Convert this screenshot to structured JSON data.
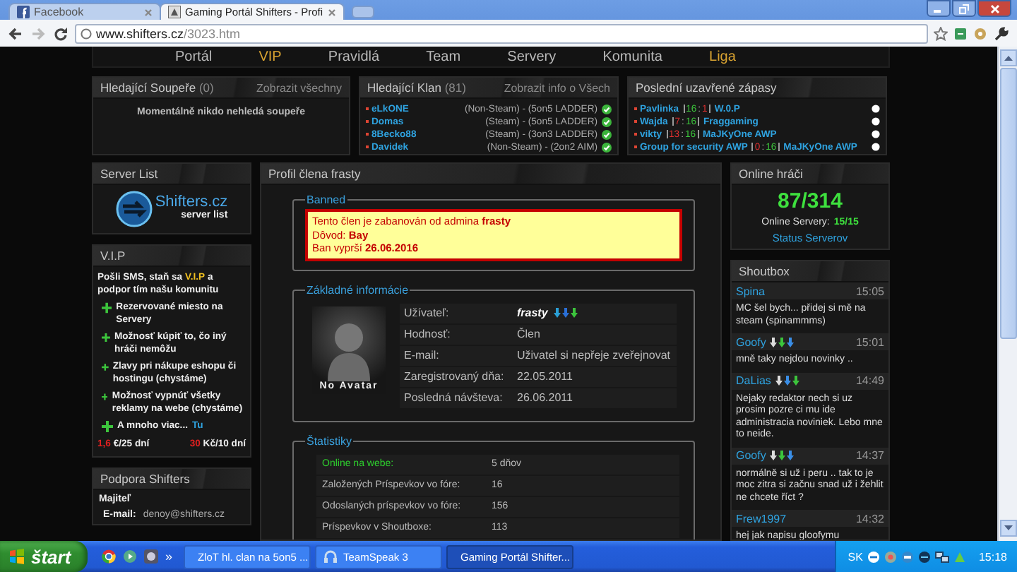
{
  "browser": {
    "tabs": [
      {
        "title": "Facebook",
        "selected": false
      },
      {
        "title": "Gaming Portál Shifters - Profi",
        "selected": true
      }
    ],
    "address": {
      "host": "www.shifters.cz",
      "path": "/3023.htm"
    }
  },
  "nav": [
    {
      "label": "Portál",
      "highlighted": false
    },
    {
      "label": "VIP",
      "highlighted": true
    },
    {
      "label": "Pravidlá",
      "highlighted": false
    },
    {
      "label": "Team",
      "highlighted": false
    },
    {
      "label": "Servery",
      "highlighted": false
    },
    {
      "label": "Komunita",
      "highlighted": false
    },
    {
      "label": "Liga",
      "highlighted": true
    }
  ],
  "seeking_opponents": {
    "title": "Hledající Soupeře",
    "count": "(0)",
    "link": "Zobrazit všechny",
    "message": "Momentálně nikdo nehledá soupeře"
  },
  "seeking_clan": {
    "title": "Hledající Klan",
    "count": "(81)",
    "link": "Zobrazit info o Všech",
    "entries": [
      {
        "name": "eLkONE",
        "details": "(Non-Steam) - (5on5 LADDER)"
      },
      {
        "name": "Domas",
        "details": "(Steam) - (5on5 LADDER)"
      },
      {
        "name": "8Becko88",
        "details": "(Steam) - (3on3 LADDER)"
      },
      {
        "name": "Davidek",
        "details": "(Non-Steam) - (2on2 AIM)"
      }
    ]
  },
  "recent_matches": {
    "title": "Poslední uzavřené zápasy",
    "separator": ":",
    "matches": [
      {
        "team_1": "Pavlinka",
        "score_1": {
          "value": "16",
          "won": true
        },
        "score_2": {
          "value": "1",
          "won": false
        },
        "team_2": "W.0.P"
      },
      {
        "team_1": "Wajda",
        "score_1": {
          "value": "7",
          "won": false
        },
        "score_2": {
          "value": "16",
          "won": true
        },
        "team_2": "Fraggaming"
      },
      {
        "team_1": "vikty",
        "score_1": {
          "value": "13",
          "won": false
        },
        "score_2": {
          "value": "16",
          "won": true
        },
        "team_2": "MaJKyOne AWP"
      },
      {
        "team_1": "Group for security AWP",
        "score_1": {
          "value": "0",
          "won": false
        },
        "score_2": {
          "value": "16",
          "won": true
        },
        "team_2": "MaJKyOne AWP"
      }
    ]
  },
  "server_list": {
    "title": "Server List",
    "logo_title": "Shifters.cz",
    "logo_subtitle": "server list"
  },
  "vip": {
    "title": "V.I.P",
    "intro": "Pošli SMS, staň sa **V.I.P** a podpor tím našu komunitu",
    "benefits": [
      "Rezervované miesto na Servery",
      "Možnosť kúpiť to, čo iný hráči nemôžu",
      "Zlavy pri nákupe eshopu či hostingu (chystáme)",
      "Možnosť vypnúť všetky reklamy na webe (chystáme)"
    ],
    "more": {
      "text": "A mnoho viac...",
      "link": "Tu"
    },
    "prices": [
      {
        "amount": "1,6",
        "unit": "€/25 dní"
      },
      {
        "amount": "30",
        "unit": "Kč/10 dní"
      }
    ]
  },
  "support": {
    "title": "Podpora Shifters",
    "role": "Majiteľ",
    "email_label": "E-mail:",
    "email": "denoy@shifters.cz"
  },
  "profile": {
    "title": "Profil člena frasty",
    "ban": {
      "legend": "Banned",
      "lines": [
        "Tento člen je zabanován od admina **frasty**",
        "Dôvod: **Bay**",
        "Ban vyprší **26.06.2016**"
      ]
    },
    "info": {
      "legend": "Základné informácie",
      "avatar_caption": "No Avatar",
      "rows": [
        {
          "kind": "user",
          "label": "Užívateľ:",
          "value": "frasty",
          "badges": [
            {
              "color": "#2a9fd6"
            },
            {
              "color": "#2a6fd6"
            },
            {
              "color": "#3cc43c"
            }
          ]
        },
        {
          "kind": "text",
          "label": "Hodnosť:",
          "value": "Člen"
        },
        {
          "kind": "text",
          "label": "E-mail:",
          "value": "Uživatel si nepřeje zveřejnovat"
        },
        {
          "kind": "text",
          "label": "Zaregistrovaný dňa:",
          "value": "22.05.2011"
        },
        {
          "kind": "text",
          "label": "Posledná návšteva:",
          "value": "26.06.2011"
        }
      ]
    },
    "stats": {
      "legend": "Štatistiky",
      "rows": [
        {
          "label": "Online na webe:",
          "value": "5 dňov",
          "highlighted": true
        },
        {
          "label": "Založených Príspevkov vo fóre:",
          "value": "16",
          "highlighted": false
        },
        {
          "label": "Odoslaných príspevkov vo fóre:",
          "value": "156",
          "highlighted": false
        },
        {
          "label": "Príspevkov v Shoutboxe:",
          "value": "113",
          "highlighted": false
        }
      ]
    }
  },
  "online": {
    "title": "Online hráči",
    "players": "87/314",
    "servers_label": "Online Servery:",
    "servers_value": "15/15",
    "status_link": "Status Serverov"
  },
  "shoutbox": {
    "title": "Shoutbox",
    "posts": [
      {
        "author": "Spina",
        "time": "15:05",
        "message": "MC šel bych... přidej si mě na steam (spinammms)"
      },
      {
        "author": "Goofy",
        "time": "15:01",
        "message": "mně taky nejdou novinky ..",
        "badges": [
          {
            "color": "#dddddd"
          },
          {
            "color": "#3cc43c"
          },
          {
            "color": "#3a8ee6"
          }
        ]
      },
      {
        "author": "DaLias",
        "time": "14:49",
        "message": "Nejaky redaktor nech si uz prosim pozre ci mu ide administracia noviniek. Lebo mne to neide.",
        "badges": [
          {
            "color": "#dddddd"
          },
          {
            "color": "#3a8ee6"
          },
          {
            "color": "#3cc43c"
          }
        ]
      },
      {
        "author": "Goofy",
        "time": "14:37",
        "message": "normálně si už i peru .. tak to je moc zitra si začnu snad už i žehlit ne chcete říct ?",
        "badges": [
          {
            "color": "#dddddd"
          },
          {
            "color": "#3cc43c"
          },
          {
            "color": "#3a8ee6"
          }
        ]
      },
      {
        "author": "Frew1997",
        "time": "14:32",
        "message": "hej jak napisu gloofymu"
      }
    ]
  },
  "taskbar": {
    "start": "štart",
    "more": "»",
    "tasks": [
      {
        "label": "ZloT hl. clan na 5on5 ...",
        "selected": false
      },
      {
        "label": "TeamSpeak 3",
        "selected": false
      },
      {
        "label": "Gaming Portál Shifter...",
        "selected": true
      }
    ],
    "language": "SK",
    "clock": "15:18"
  }
}
